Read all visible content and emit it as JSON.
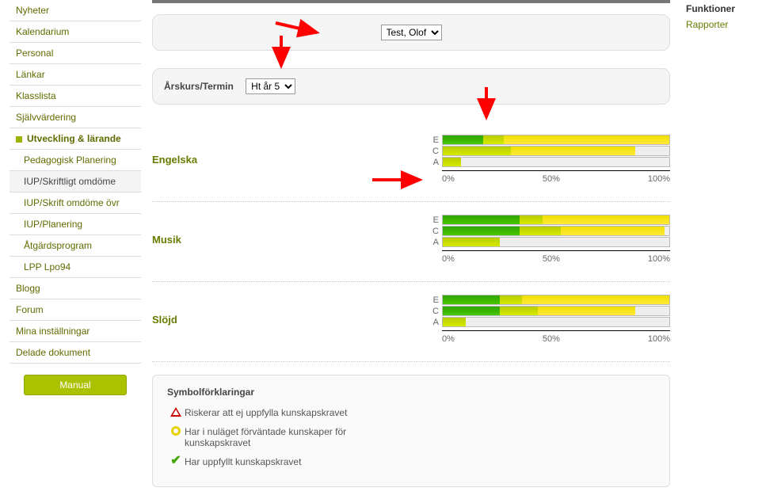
{
  "sidebar": {
    "items": [
      {
        "label": "Nyheter"
      },
      {
        "label": "Kalendarium"
      },
      {
        "label": "Personal"
      },
      {
        "label": "Länkar"
      },
      {
        "label": "Klasslista"
      },
      {
        "label": "Självvärdering"
      },
      {
        "label": "Utveckling & lärande",
        "bullet": true
      },
      {
        "label": "Pedagogisk Planering",
        "sub": true
      },
      {
        "label": "IUP/Skriftligt omdöme",
        "sub": true,
        "active": true
      },
      {
        "label": "IUP/Skrift omdöme övr",
        "sub": true
      },
      {
        "label": "IUP/Planering",
        "sub": true
      },
      {
        "label": "Åtgärdsprogram",
        "sub": true
      },
      {
        "label": "LPP Lpo94",
        "sub": true
      },
      {
        "label": "Blogg"
      },
      {
        "label": "Forum"
      },
      {
        "label": "Mina inställningar"
      },
      {
        "label": "Delade dokument"
      }
    ],
    "manual_button": "Manual"
  },
  "top_panel": {
    "selected_student": "Test, Olof"
  },
  "filter_panel": {
    "label": "Årskurs/Termin",
    "selected": "Ht år 5"
  },
  "chart_data": {
    "type": "bar",
    "axis_ticks": [
      "0%",
      "50%",
      "100%"
    ],
    "row_labels": [
      "E",
      "C",
      "A"
    ],
    "subjects": [
      {
        "name": "Engelska",
        "rows": [
          {
            "green": 18,
            "ygreen": 27,
            "yellow": 100
          },
          {
            "green": 0,
            "ygreen": 30,
            "yellow": 85
          },
          {
            "green": 0,
            "ygreen": 8,
            "yellow": 8
          }
        ]
      },
      {
        "name": "Musik",
        "rows": [
          {
            "green": 34,
            "ygreen": 44,
            "yellow": 100
          },
          {
            "green": 34,
            "ygreen": 52,
            "yellow": 98
          },
          {
            "green": 0,
            "ygreen": 25,
            "yellow": 25
          }
        ]
      },
      {
        "name": "Slöjd",
        "rows": [
          {
            "green": 25,
            "ygreen": 35,
            "yellow": 100
          },
          {
            "green": 25,
            "ygreen": 42,
            "yellow": 85
          },
          {
            "green": 0,
            "ygreen": 10,
            "yellow": 10
          }
        ]
      }
    ]
  },
  "legend": {
    "heading": "Symbolförklaringar",
    "risk": "Riskerar att ej uppfylla kunskapskravet",
    "expect": "Har i nuläget förväntade kunskaper för kunskapskravet",
    "pass": "Har uppfyllt kunskapskravet"
  },
  "right": {
    "heading": "Funktioner",
    "link": "Rapporter"
  }
}
